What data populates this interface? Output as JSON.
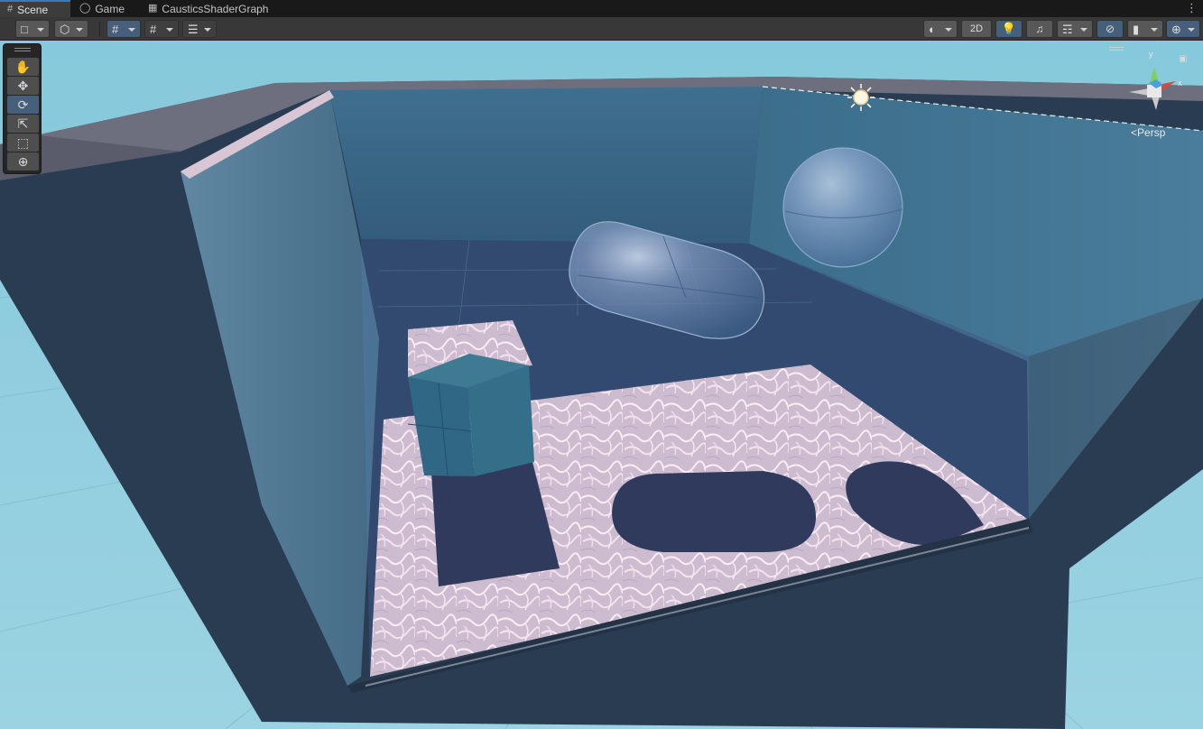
{
  "tabs": [
    {
      "label": "Scene",
      "icon": "hash-icon",
      "active": true
    },
    {
      "label": "Game",
      "icon": "gamepad-icon",
      "active": false
    },
    {
      "label": "CausticsShaderGraph",
      "icon": "shader-graph-icon",
      "active": false
    }
  ],
  "toolbar": {
    "view_2d": "2D",
    "icons": [
      "draw-mode-icon",
      "render-paths-icon",
      "grid-snap-icon",
      "increment-snap-icon",
      "align-icon",
      "shading-sphere-icon",
      "light-bulb-icon",
      "audio-icon",
      "effects-icon",
      "hidden-objects-icon",
      "camera-icon",
      "gizmos-icon"
    ]
  },
  "tools": [
    "hand-tool",
    "move-tool",
    "rotate-tool",
    "scale-tool",
    "rect-tool",
    "transform-tool"
  ],
  "active_tool": "rotate-tool",
  "gizmo": {
    "projection_label": "Persp",
    "y_label": "y",
    "x_label": "x"
  },
  "colors": {
    "sky": "#8fcfe0",
    "ground": "#9ad4e2",
    "tank_outer": "#2a3c52",
    "water_glass": "#5a9ab8",
    "shadow": "#2f3a5c",
    "caustic_floor": "#d8c8d8",
    "accent_blue": "#3a79bb"
  }
}
